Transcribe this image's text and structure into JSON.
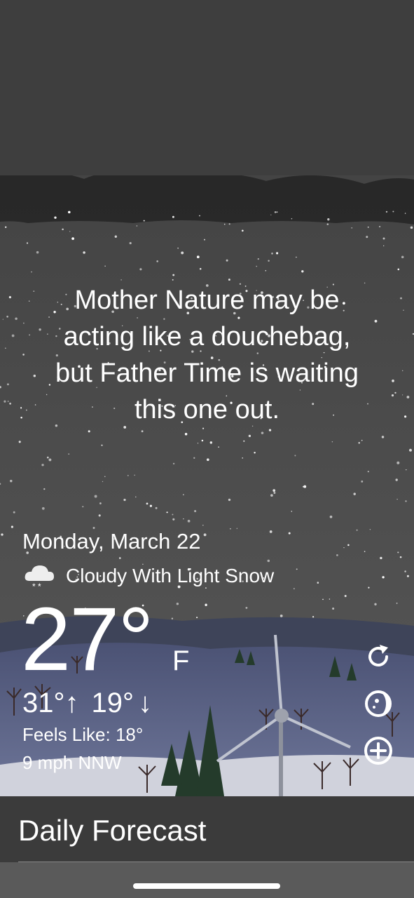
{
  "quote": {
    "line1": "Mother Nature may be",
    "line2": "acting like a douchebag,",
    "line3": "but Father Time is waiting",
    "line4": "this one out."
  },
  "weather": {
    "date": "Monday, March 22",
    "condition": "Cloudy With Light Snow",
    "condition_icon": "cloud-snow-icon",
    "temperature": "27°",
    "unit": "F",
    "high": "31°",
    "low": "19°",
    "feels_like": "Feels Like: 18°",
    "wind": "9 mph NNW"
  },
  "actions": {
    "refresh_icon": "refresh-icon",
    "moon_icon": "moon-phase-icon",
    "add_icon": "add-location-icon"
  },
  "footer": {
    "title": "Daily Forecast"
  },
  "colors": {
    "sky": "#535353",
    "cloud": "#2a2a2a",
    "hills": "#5c6690",
    "snow_ground": "#d9dbe4",
    "footer": "#3b3b3b"
  }
}
